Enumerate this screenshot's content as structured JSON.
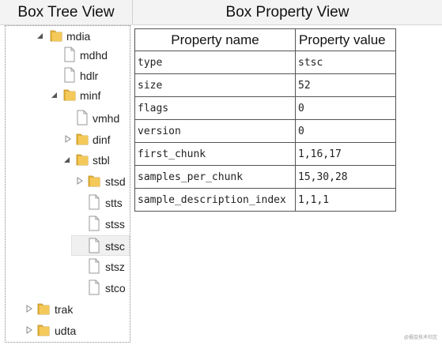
{
  "headers": {
    "tree_title": "Box Tree View",
    "property_title": "Box Property View"
  },
  "tree": {
    "nodes": [
      {
        "label": "mdia",
        "type": "folder",
        "expander": "expanded"
      },
      {
        "label": "mdhd",
        "type": "file",
        "expander": "none"
      },
      {
        "label": "hdlr",
        "type": "file",
        "expander": "none"
      },
      {
        "label": "minf",
        "type": "folder",
        "expander": "expanded"
      },
      {
        "label": "vmhd",
        "type": "file",
        "expander": "none"
      },
      {
        "label": "dinf",
        "type": "folder",
        "expander": "collapsed"
      },
      {
        "label": "stbl",
        "type": "folder",
        "expander": "expanded"
      },
      {
        "label": "stsd",
        "type": "folder",
        "expander": "collapsed"
      },
      {
        "label": "stts",
        "type": "file",
        "expander": "none"
      },
      {
        "label": "stss",
        "type": "file",
        "expander": "none"
      },
      {
        "label": "stsc",
        "type": "file",
        "expander": "none",
        "selected": true
      },
      {
        "label": "stsz",
        "type": "file",
        "expander": "none"
      },
      {
        "label": "stco",
        "type": "file",
        "expander": "none"
      },
      {
        "label": "trak",
        "type": "folder",
        "expander": "collapsed"
      },
      {
        "label": "udta",
        "type": "folder",
        "expander": "collapsed"
      }
    ]
  },
  "property_table": {
    "columns": [
      "Property name",
      "Property value"
    ],
    "rows": [
      {
        "name": "type",
        "value": "stsc"
      },
      {
        "name": "size",
        "value": "52"
      },
      {
        "name": "flags",
        "value": "0"
      },
      {
        "name": "version",
        "value": "0"
      },
      {
        "name": "first_chunk",
        "value": "1,16,17"
      },
      {
        "name": "samples_per_chunk",
        "value": "15,30,28"
      },
      {
        "name": "sample_description_index",
        "value": "1,1,1"
      }
    ]
  },
  "watermark": "@掘金技术社区",
  "colors": {
    "folder": "#e8b53a",
    "header_bg": "#f3f3f3",
    "selection_bg": "#f0f0f0"
  }
}
